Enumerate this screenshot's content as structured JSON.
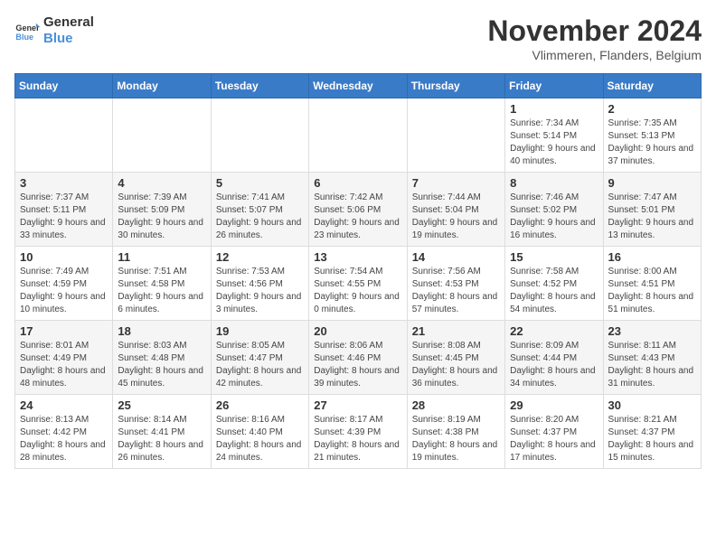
{
  "logo": {
    "line1": "General",
    "line2": "Blue"
  },
  "title": "November 2024",
  "subtitle": "Vlimmeren, Flanders, Belgium",
  "days_of_week": [
    "Sunday",
    "Monday",
    "Tuesday",
    "Wednesday",
    "Thursday",
    "Friday",
    "Saturday"
  ],
  "weeks": [
    [
      {
        "day": "",
        "info": ""
      },
      {
        "day": "",
        "info": ""
      },
      {
        "day": "",
        "info": ""
      },
      {
        "day": "",
        "info": ""
      },
      {
        "day": "",
        "info": ""
      },
      {
        "day": "1",
        "info": "Sunrise: 7:34 AM\nSunset: 5:14 PM\nDaylight: 9 hours and 40 minutes."
      },
      {
        "day": "2",
        "info": "Sunrise: 7:35 AM\nSunset: 5:13 PM\nDaylight: 9 hours and 37 minutes."
      }
    ],
    [
      {
        "day": "3",
        "info": "Sunrise: 7:37 AM\nSunset: 5:11 PM\nDaylight: 9 hours and 33 minutes."
      },
      {
        "day": "4",
        "info": "Sunrise: 7:39 AM\nSunset: 5:09 PM\nDaylight: 9 hours and 30 minutes."
      },
      {
        "day": "5",
        "info": "Sunrise: 7:41 AM\nSunset: 5:07 PM\nDaylight: 9 hours and 26 minutes."
      },
      {
        "day": "6",
        "info": "Sunrise: 7:42 AM\nSunset: 5:06 PM\nDaylight: 9 hours and 23 minutes."
      },
      {
        "day": "7",
        "info": "Sunrise: 7:44 AM\nSunset: 5:04 PM\nDaylight: 9 hours and 19 minutes."
      },
      {
        "day": "8",
        "info": "Sunrise: 7:46 AM\nSunset: 5:02 PM\nDaylight: 9 hours and 16 minutes."
      },
      {
        "day": "9",
        "info": "Sunrise: 7:47 AM\nSunset: 5:01 PM\nDaylight: 9 hours and 13 minutes."
      }
    ],
    [
      {
        "day": "10",
        "info": "Sunrise: 7:49 AM\nSunset: 4:59 PM\nDaylight: 9 hours and 10 minutes."
      },
      {
        "day": "11",
        "info": "Sunrise: 7:51 AM\nSunset: 4:58 PM\nDaylight: 9 hours and 6 minutes."
      },
      {
        "day": "12",
        "info": "Sunrise: 7:53 AM\nSunset: 4:56 PM\nDaylight: 9 hours and 3 minutes."
      },
      {
        "day": "13",
        "info": "Sunrise: 7:54 AM\nSunset: 4:55 PM\nDaylight: 9 hours and 0 minutes."
      },
      {
        "day": "14",
        "info": "Sunrise: 7:56 AM\nSunset: 4:53 PM\nDaylight: 8 hours and 57 minutes."
      },
      {
        "day": "15",
        "info": "Sunrise: 7:58 AM\nSunset: 4:52 PM\nDaylight: 8 hours and 54 minutes."
      },
      {
        "day": "16",
        "info": "Sunrise: 8:00 AM\nSunset: 4:51 PM\nDaylight: 8 hours and 51 minutes."
      }
    ],
    [
      {
        "day": "17",
        "info": "Sunrise: 8:01 AM\nSunset: 4:49 PM\nDaylight: 8 hours and 48 minutes."
      },
      {
        "day": "18",
        "info": "Sunrise: 8:03 AM\nSunset: 4:48 PM\nDaylight: 8 hours and 45 minutes."
      },
      {
        "day": "19",
        "info": "Sunrise: 8:05 AM\nSunset: 4:47 PM\nDaylight: 8 hours and 42 minutes."
      },
      {
        "day": "20",
        "info": "Sunrise: 8:06 AM\nSunset: 4:46 PM\nDaylight: 8 hours and 39 minutes."
      },
      {
        "day": "21",
        "info": "Sunrise: 8:08 AM\nSunset: 4:45 PM\nDaylight: 8 hours and 36 minutes."
      },
      {
        "day": "22",
        "info": "Sunrise: 8:09 AM\nSunset: 4:44 PM\nDaylight: 8 hours and 34 minutes."
      },
      {
        "day": "23",
        "info": "Sunrise: 8:11 AM\nSunset: 4:43 PM\nDaylight: 8 hours and 31 minutes."
      }
    ],
    [
      {
        "day": "24",
        "info": "Sunrise: 8:13 AM\nSunset: 4:42 PM\nDaylight: 8 hours and 28 minutes."
      },
      {
        "day": "25",
        "info": "Sunrise: 8:14 AM\nSunset: 4:41 PM\nDaylight: 8 hours and 26 minutes."
      },
      {
        "day": "26",
        "info": "Sunrise: 8:16 AM\nSunset: 4:40 PM\nDaylight: 8 hours and 24 minutes."
      },
      {
        "day": "27",
        "info": "Sunrise: 8:17 AM\nSunset: 4:39 PM\nDaylight: 8 hours and 21 minutes."
      },
      {
        "day": "28",
        "info": "Sunrise: 8:19 AM\nSunset: 4:38 PM\nDaylight: 8 hours and 19 minutes."
      },
      {
        "day": "29",
        "info": "Sunrise: 8:20 AM\nSunset: 4:37 PM\nDaylight: 8 hours and 17 minutes."
      },
      {
        "day": "30",
        "info": "Sunrise: 8:21 AM\nSunset: 4:37 PM\nDaylight: 8 hours and 15 minutes."
      }
    ]
  ]
}
